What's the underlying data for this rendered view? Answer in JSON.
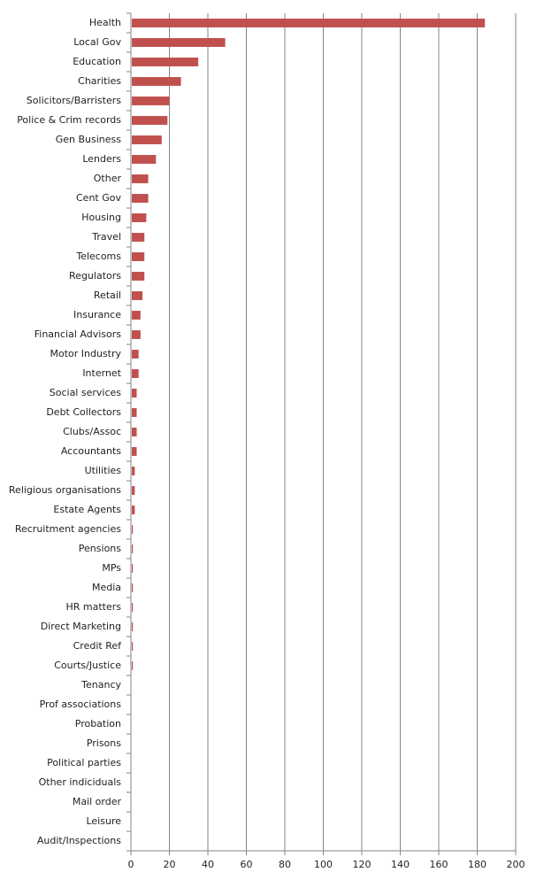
{
  "chart_data": {
    "type": "bar",
    "orientation": "horizontal",
    "title": "",
    "xlabel": "",
    "ylabel": "",
    "xlim": [
      0,
      200
    ],
    "xticks": [
      0,
      20,
      40,
      60,
      80,
      100,
      120,
      140,
      160,
      180,
      200
    ],
    "grid": true,
    "legend": "none",
    "bar_color": "#c0504d",
    "categories": [
      "Health",
      "Local Gov",
      "Education",
      "Charities",
      "Solicitors/Barristers",
      "Police & Crim records",
      "Gen Business",
      "Lenders",
      "Other",
      "Cent Gov",
      "Housing",
      "Travel",
      "Telecoms",
      "Regulators",
      "Retail",
      "Insurance",
      "Financial Advisors",
      "Motor Industry",
      "Internet",
      "Social services",
      "Debt Collectors",
      "Clubs/Assoc",
      "Accountants",
      "Utilities",
      "Religious organisations",
      "Estate Agents",
      "Recruitment agencies",
      "Pensions",
      "MPs",
      "Media",
      "HR matters",
      "Direct Marketing",
      "Credit Ref",
      "Courts/Justice",
      "Tenancy",
      "Prof associations",
      "Probation",
      "Prisons",
      "Political parties",
      "Other indicidual​s",
      "Mail order",
      "Leisure",
      "Audit/Inspections"
    ],
    "values": [
      184,
      49,
      35,
      26,
      20,
      19,
      16,
      13,
      9,
      9,
      8,
      7,
      7,
      7,
      6,
      5,
      5,
      4,
      4,
      3,
      3,
      3,
      3,
      2,
      2,
      2,
      1,
      1,
      1,
      1,
      1,
      1,
      1,
      1,
      0,
      0,
      0,
      0,
      0,
      0,
      0,
      0,
      0
    ]
  }
}
